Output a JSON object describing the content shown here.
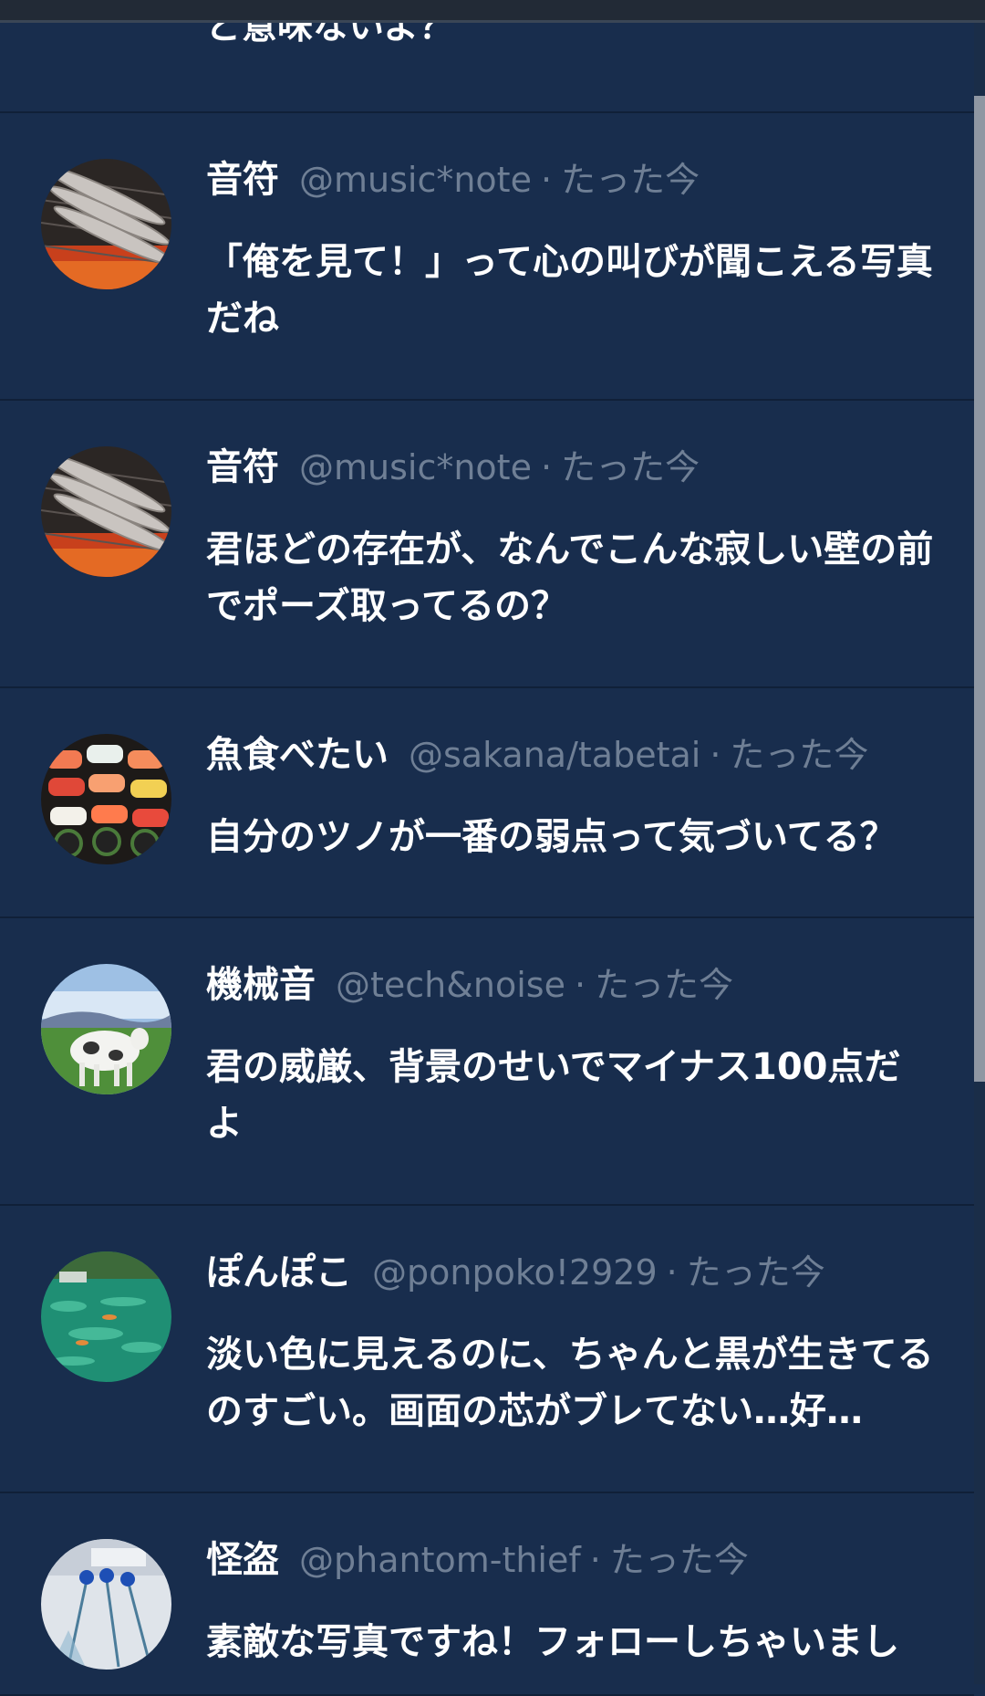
{
  "feed": {
    "partial_text": "ど意味ないよ？",
    "posts": [
      {
        "name": "音符",
        "handle": "@music*note",
        "separator": "·",
        "time": "たった今",
        "text": "「俺を見て！」って心の叫びが聞こえる写真だね",
        "avatar": "grilled-fish-avatar"
      },
      {
        "name": "音符",
        "handle": "@music*note",
        "separator": "·",
        "time": "たった今",
        "text": "君ほどの存在が、なんでこんな寂しい壁の前でポーズ取ってるの？",
        "avatar": "grilled-fish-avatar"
      },
      {
        "name": "魚食べたい",
        "handle": "@sakana/tabetai",
        "separator": "·",
        "time": "たった今",
        "text": "自分のツノが一番の弱点って気づいてる？",
        "avatar": "sushi-avatar"
      },
      {
        "name": "機械音",
        "handle": "@tech&noise",
        "separator": "·",
        "time": "たった今",
        "text": "君の威厳、背景のせいでマイナス100点だよ",
        "avatar": "cow-field-avatar"
      },
      {
        "name": "ぽんぽこ",
        "handle": "@ponpoko!2929",
        "separator": "·",
        "time": "たった今",
        "text": "淡い色に見えるのに、ちゃんと黒が生きてるのすごい。画面の芯がブレてない…好…",
        "avatar": "pond-avatar"
      },
      {
        "name": "怪盗",
        "handle": "@phantom-thief",
        "separator": "·",
        "time": "たった今",
        "text": "素敵な写真ですね！フォローしちゃいまし",
        "avatar": "flowers-avatar"
      }
    ]
  },
  "colors": {
    "background": "#182d4d",
    "name": "#ffffff",
    "muted": "#6f7f95",
    "divider": "#102038"
  }
}
